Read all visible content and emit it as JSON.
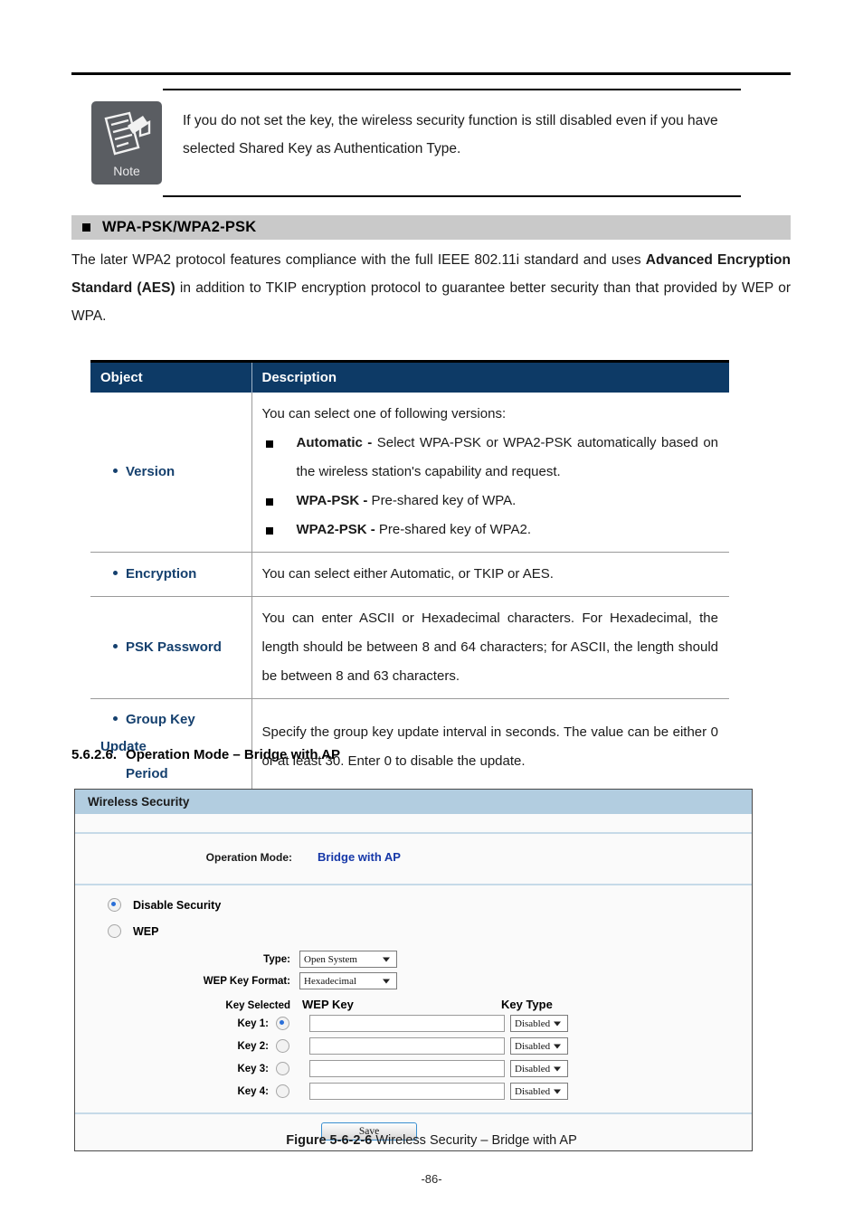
{
  "note": {
    "icon_label": "Note",
    "text": "If you do not set the key, the wireless security function is still disabled even if you have selected Shared Key as Authentication Type."
  },
  "section": {
    "title": "WPA-PSK/WPA2-PSK",
    "intro_part1": "The later WPA2 protocol features compliance with the full IEEE 802.11i standard and uses ",
    "intro_bold1": "Advanced Encryption Standard (AES)",
    "intro_part2": " in addition to TKIP encryption protocol to guarantee better security than that provided by WEP or WPA."
  },
  "spec_table": {
    "headers": [
      "Object",
      "Description"
    ],
    "rows": [
      {
        "object": "Version",
        "object_line2": "",
        "desc_intro": "You can select one of following versions:",
        "bullets": [
          {
            "bold": "Automatic -",
            "text": " Select WPA-PSK or WPA2-PSK automatically based on the wireless station's capability and request."
          },
          {
            "bold": "WPA-PSK -",
            "text": " Pre-shared key of WPA."
          },
          {
            "bold": "WPA2-PSK -",
            "text": " Pre-shared key of WPA2."
          }
        ]
      },
      {
        "object": "Encryption",
        "object_line2": "",
        "desc_intro": "You can select either Automatic, or TKIP or AES.",
        "bullets": []
      },
      {
        "object": "PSK Password",
        "object_line2": "",
        "desc_intro": "You can enter ASCII or Hexadecimal characters. For Hexadecimal, the length should be between 8 and 64 characters; for ASCII, the length should be between 8 and 63 characters.",
        "bullets": []
      },
      {
        "object": "Group Key Update",
        "object_line2": "Period",
        "desc_intro": "Specify the group key update interval in seconds. The value can be either 0 or at least 30. Enter 0 to disable the update.",
        "bullets": []
      }
    ]
  },
  "subsection": {
    "number": "5.6.2.6.",
    "title": "Operation Mode – Bridge with AP"
  },
  "router_ui": {
    "panel_title": "Wireless Security",
    "operation_mode_label": "Operation Mode:",
    "operation_mode_value": "Bridge with AP",
    "security_options": [
      {
        "label": "Disable Security",
        "selected": true
      },
      {
        "label": "WEP",
        "selected": false
      }
    ],
    "type_label": "Type:",
    "type_value": "Open System",
    "wep_key_format_label": "WEP Key Format:",
    "wep_key_format_value": "Hexadecimal",
    "column_headers": {
      "key_selected": "Key Selected",
      "wep_key": "WEP Key",
      "key_type": "Key Type"
    },
    "keys": [
      {
        "label": "Key 1:",
        "selected": true,
        "value": "",
        "key_type": "Disabled"
      },
      {
        "label": "Key 2:",
        "selected": false,
        "value": "",
        "key_type": "Disabled"
      },
      {
        "label": "Key 3:",
        "selected": false,
        "value": "",
        "key_type": "Disabled"
      },
      {
        "label": "Key 4:",
        "selected": false,
        "value": "",
        "key_type": "Disabled"
      }
    ],
    "save_label": "Save"
  },
  "figure": {
    "label": "Figure 5-6-2-6",
    "caption": " Wireless Security – Bridge with AP"
  },
  "page_number": "-86-",
  "colors": {
    "table_header_bg": "#0d3a66",
    "object_text": "#15406e",
    "section_bar_bg": "#c9c9c9",
    "panel_title_bg": "#b2cde0",
    "ui_value_blue": "#1638a8"
  }
}
